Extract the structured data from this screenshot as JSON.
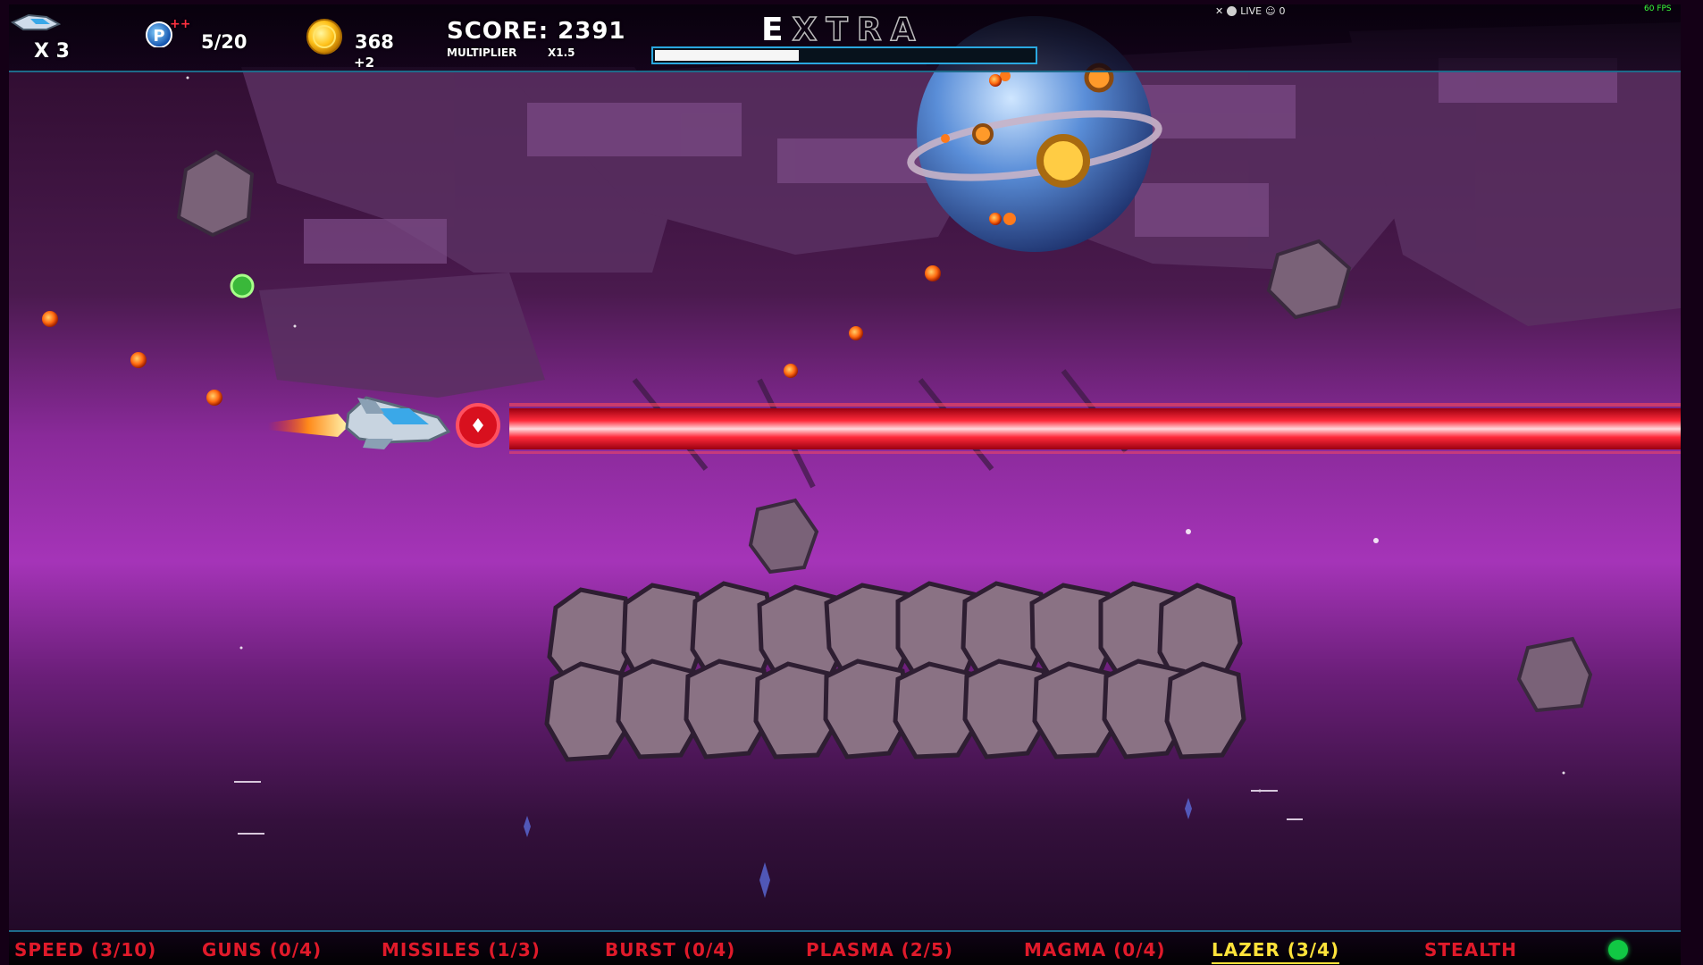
{
  "hud": {
    "lives": "X 3",
    "power": {
      "badge": "P",
      "plus": "++",
      "count": "5/20"
    },
    "coins": {
      "count": "368",
      "bonus": "+2"
    },
    "score": {
      "label": "SCORE: 2391",
      "multiplier_label": "MULTIPLIER",
      "multiplier_value": "X1.5"
    },
    "extra": {
      "letters": [
        "E",
        "X",
        "T",
        "R",
        "A"
      ],
      "lit": [
        true,
        false,
        false,
        false,
        false
      ],
      "progress": 0.38
    },
    "stream": {
      "live": "LIVE",
      "viewers": "0"
    },
    "fps": "60 FPS"
  },
  "weapons": [
    {
      "label": "SPEED (3/10)",
      "active": false
    },
    {
      "label": "GUNS (0/4)",
      "active": false
    },
    {
      "label": "MISSILES (1/3)",
      "active": false
    },
    {
      "label": "BURST (0/4)",
      "active": false
    },
    {
      "label": "PLASMA (2/5)",
      "active": false
    },
    {
      "label": "MAGMA (0/4)",
      "active": false
    },
    {
      "label": "LAZER (3/4)",
      "active": true
    },
    {
      "label": "STEALTH",
      "active": false
    }
  ],
  "colors": {
    "weapon_inactive": "#e01a2a",
    "weapon_active": "#ffe23a",
    "status_light": "#11c844",
    "extra_lit": "#ffffff",
    "extra_dim": "#bcbcbc",
    "extra_bar_border": "#2aa8e0"
  },
  "icons": [
    "player-ship-icon",
    "power-p-icon",
    "coin-icon",
    "mic-off-icon",
    "record-icon",
    "viewers-icon",
    "status-light-icon"
  ]
}
